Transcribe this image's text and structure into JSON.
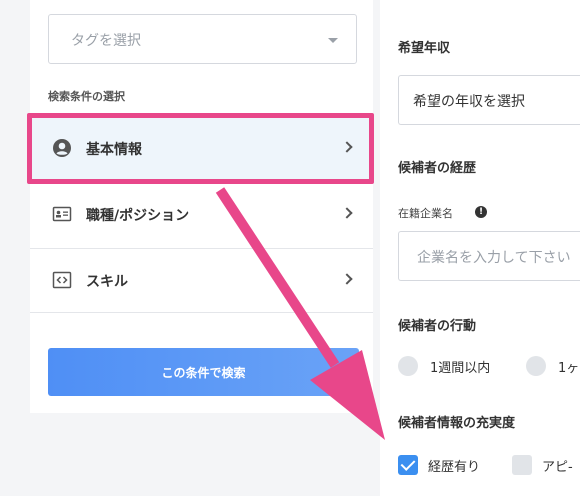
{
  "left_panel": {
    "tag_select_placeholder": "タグを選択",
    "section_label": "検索条件の選択",
    "menu": [
      {
        "label": "基本情報",
        "icon": "user-circle-icon"
      },
      {
        "label": "職種/ポジション",
        "icon": "id-card-icon"
      },
      {
        "label": "スキル",
        "icon": "code-icon"
      }
    ],
    "search_button": "この条件で検索"
  },
  "right_panel": {
    "income_heading": "希望年収",
    "income_select": "希望の年収を選択",
    "history_heading": "候補者の経歴",
    "company_label": "在籍企業名",
    "company_placeholder": "企業名を入力して下さい",
    "action_heading": "候補者の行動",
    "action_options": [
      "1週間以内",
      "1ヶ"
    ],
    "fill_heading": "候補者情報の充実度",
    "fill_options": [
      "経歴有り",
      "アピ-"
    ]
  },
  "colors": {
    "highlight": "#e8478a",
    "accent": "#4f8ff5",
    "selected_bg": "#eef5fb"
  }
}
